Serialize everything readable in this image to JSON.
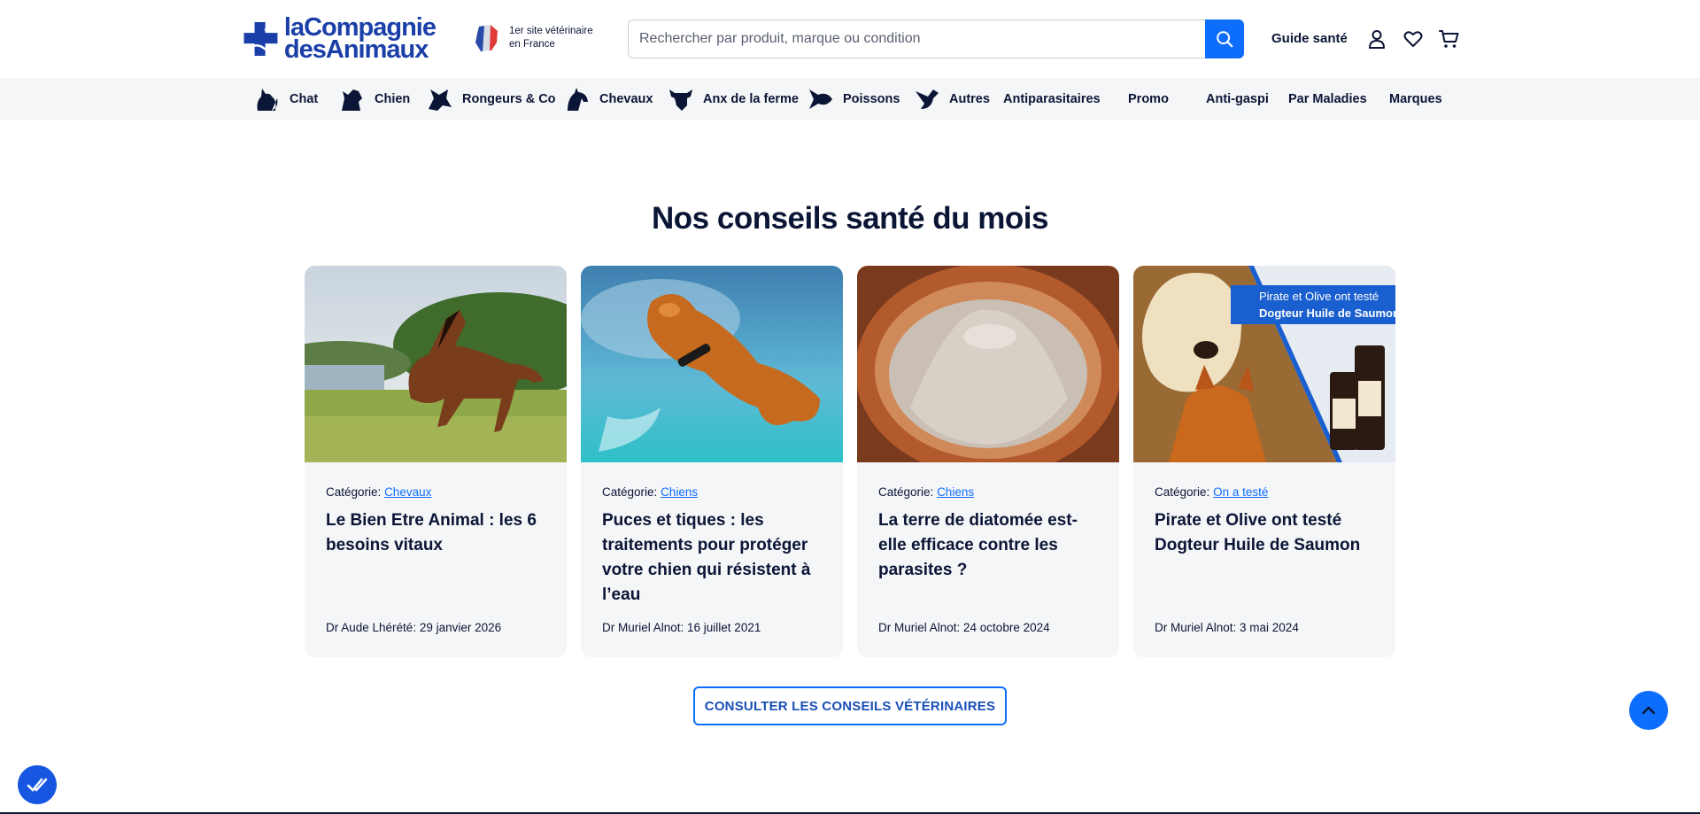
{
  "header": {
    "logo_line1": "laCompagnie",
    "logo_line2": "desAnimaux",
    "badge_line1": "1er site vétérinaire",
    "badge_line2": "en France",
    "search_placeholder": "Rechercher par produit, marque ou condition",
    "guide_label": "Guide santé",
    "icons": [
      "search-icon",
      "user-icon",
      "heart-icon",
      "cart-icon"
    ]
  },
  "nav": {
    "items": [
      {
        "label": "Chat",
        "icon": "cat-icon"
      },
      {
        "label": "Chien",
        "icon": "dog-icon"
      },
      {
        "label": "Rongeurs & Co",
        "icon": "rodent-icon"
      },
      {
        "label": "Chevaux",
        "icon": "horse-icon"
      },
      {
        "label": "Anx de la ferme",
        "icon": "cow-icon"
      },
      {
        "label": "Poissons",
        "icon": "fish-icon"
      },
      {
        "label": "Autres",
        "icon": "bird-icon"
      },
      {
        "label": "Antiparasitaires"
      },
      {
        "label": "Promo"
      },
      {
        "label": "Anti-gaspi"
      },
      {
        "label": "Par Maladies"
      },
      {
        "label": "Marques"
      }
    ]
  },
  "section": {
    "title": "Nos conseils santé du mois",
    "category_prefix": "Catégorie:",
    "cards": [
      {
        "category": "Chevaux",
        "title": "Le Bien Etre Animal : les 6 besoins vitaux",
        "meta": "Dr Aude Lhérété: 29 janvier 2026",
        "image": "horse-photo"
      },
      {
        "category": "Chiens",
        "title": "Puces et tiques : les traitements pour protéger votre chien qui résistent à l’eau",
        "meta": "Dr Muriel Alnot: 16 juillet 2021",
        "image": "swimming-dog-photo"
      },
      {
        "category": "Chiens",
        "title": "La terre de diatomée est-elle efficace contre les parasites ?",
        "meta": "Dr Muriel Alnot: 24 octobre 2024",
        "image": "diatomaceous-earth-photo"
      },
      {
        "category": "On a testé",
        "title": "Pirate et Olive ont testé Dogteur Huile de Saumon",
        "meta": "Dr Muriel Alnot: 3 mai 2024",
        "image": "dog-cat-product-photo",
        "overlay_line1": "Pirate et Olive ont testé",
        "overlay_line2": "Dogteur Huile de Saumon"
      }
    ],
    "cta_label": "CONSULTER LES CONSEILS VÉTÉRINAIRES"
  },
  "colors": {
    "brand_blue": "#0d6efd",
    "navy": "#0b1535",
    "card_bg": "#f5f6f8"
  }
}
